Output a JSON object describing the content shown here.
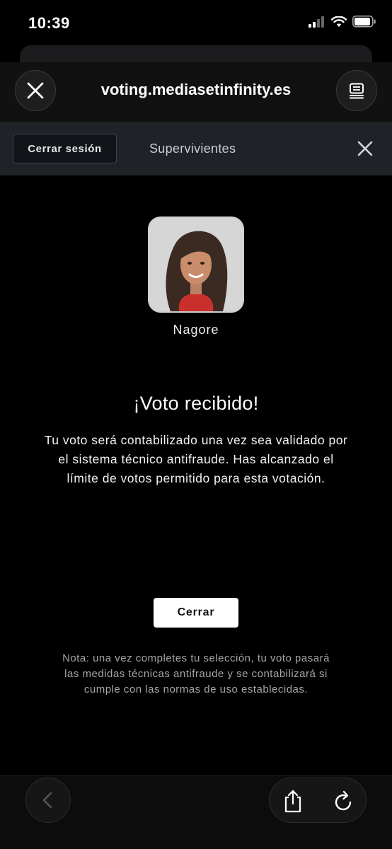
{
  "status_bar": {
    "time": "10:39"
  },
  "browser": {
    "url": "voting.mediasetinfinity.es"
  },
  "site_nav": {
    "logout_label": "Cerrar sesión",
    "title": "Supervivientes"
  },
  "contestant": {
    "name": "Nagore"
  },
  "confirmation": {
    "headline": "¡Voto recibido!",
    "message": "Tu voto será contabilizado una vez sea validado por el sistema técnico antifraude. Has alcanzado el límite de votos permitido para esta votación.",
    "close_label": "Cerrar",
    "note": "Nota: una vez completes tu selección, tu voto pasará las medidas técnicas antifraude y se contabilizará si cumple con las normas de uso establecidas."
  },
  "icons": {
    "status": [
      "signal-icon",
      "wifi-icon",
      "battery-icon"
    ],
    "header": [
      "close-icon",
      "reader-icon"
    ],
    "nav": [
      "close-icon"
    ],
    "toolbar": [
      "back-icon",
      "share-icon",
      "reload-icon"
    ]
  }
}
